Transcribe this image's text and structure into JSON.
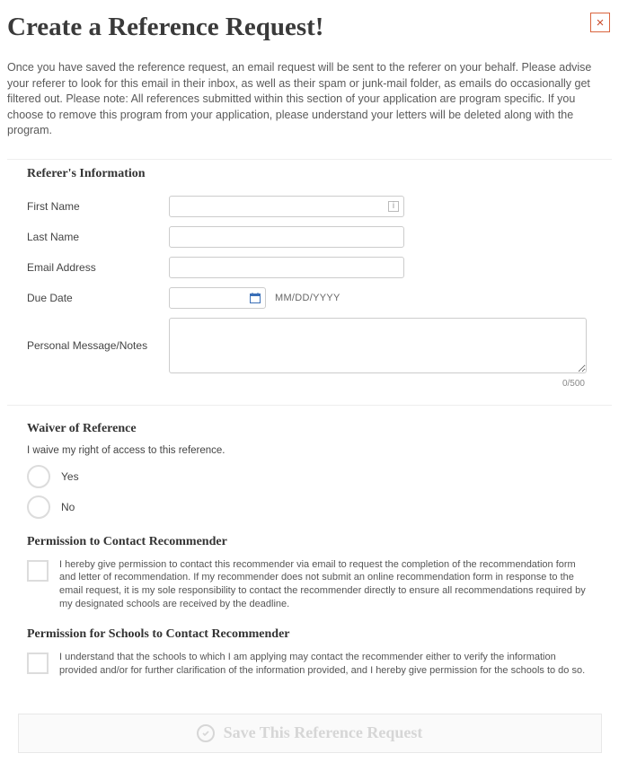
{
  "header": {
    "title": "Create a Reference Request!",
    "close_icon": "×"
  },
  "intro": "Once you have saved the reference request, an email request will be sent to the referer on your behalf. Please advise your referer to look for this email in their inbox, as well as their spam or junk-mail folder, as emails do occasionally get filtered out. Please note: All references submitted within this section of your application are program specific. If you choose to remove this program from your application, please understand your letters will be deleted along with the program.",
  "referer": {
    "section_title": "Referer's Information",
    "labels": {
      "first_name": "First Name",
      "last_name": "Last Name",
      "email": "Email Address",
      "due_date": "Due Date",
      "notes": "Personal Message/Notes"
    },
    "values": {
      "first_name": "",
      "last_name": "",
      "email": "",
      "due_date": "",
      "notes": ""
    },
    "date_hint": "MM/DD/YYYY",
    "counter": "0/500"
  },
  "waiver": {
    "section_title": "Waiver of Reference",
    "question": "I waive my right of access to this reference.",
    "options": {
      "yes": "Yes",
      "no": "No"
    }
  },
  "perm_contact": {
    "section_title": "Permission to Contact Recommender",
    "text": "I hereby give permission to contact this recommender via email to request the completion of the recommendation form and letter of recommendation. If my recommender does not submit an online recommendation form in response to the email request, it is my sole responsibility to contact the recommender directly to ensure all recommendations required by my designated schools are received by the deadline."
  },
  "perm_schools": {
    "section_title": "Permission for Schools to Contact Recommender",
    "text": "I understand that the schools to which I am applying may contact the recommender either to verify the information provided and/or for further clarification of the information provided, and I hereby give permission for the schools to do so."
  },
  "save_button": "Save This Reference Request"
}
